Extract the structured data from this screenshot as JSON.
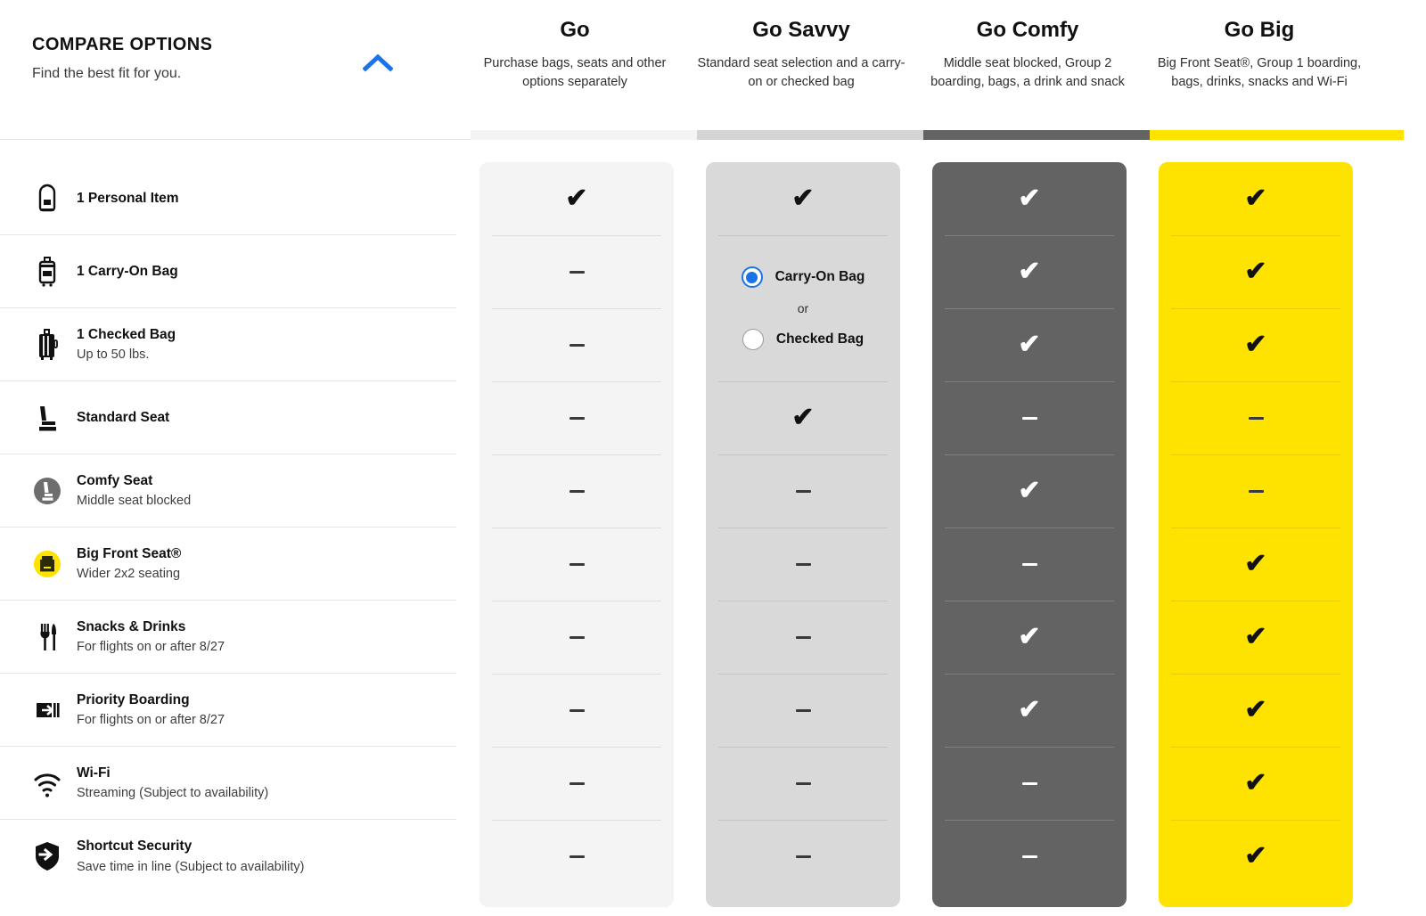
{
  "header": {
    "title": "COMPARE OPTIONS",
    "subtitle": "Find the best fit for you.",
    "collapse_icon": "chevron-up-icon",
    "accent_color": "#1a73e8"
  },
  "plans": [
    {
      "id": "go",
      "name": "Go",
      "description": "Purchase bags, seats and other options separately",
      "bar_color": "#f4f4f4",
      "card_color": "#f4f4f4",
      "theme": "light"
    },
    {
      "id": "go-savvy",
      "name": "Go Savvy",
      "description": "Standard seat selection and a carry-on or checked bag",
      "bar_color": "#d4d4d4",
      "card_color": "#d9d9d9",
      "theme": "light"
    },
    {
      "id": "go-comfy",
      "name": "Go Comfy",
      "description": "Middle seat blocked, Group 2 boarding, bags, a drink and snack",
      "bar_color": "#636363",
      "card_color": "#636363",
      "theme": "dark"
    },
    {
      "id": "go-big",
      "name": "Go Big",
      "description": "Big Front Seat®, Group 1 boarding, bags, drinks, snacks and Wi-Fi",
      "bar_color": "#ffe300",
      "card_color": "#ffe300",
      "theme": "light"
    }
  ],
  "features": [
    {
      "icon": "backpack-icon",
      "title": "1 Personal Item",
      "sub": ""
    },
    {
      "icon": "carry-on-bag-icon",
      "title": "1 Carry-On Bag",
      "sub": ""
    },
    {
      "icon": "checked-bag-icon",
      "title": "1 Checked Bag",
      "sub": "Up to 50 lbs."
    },
    {
      "icon": "standard-seat-icon",
      "title": "Standard Seat",
      "sub": ""
    },
    {
      "icon": "comfy-seat-icon",
      "title": "Comfy Seat",
      "sub": "Middle seat blocked"
    },
    {
      "icon": "big-front-seat-icon",
      "title": "Big Front Seat®",
      "sub": "Wider 2x2 seating"
    },
    {
      "icon": "snacks-drinks-icon",
      "title": "Snacks & Drinks",
      "sub": "For flights on or after 8/27"
    },
    {
      "icon": "priority-boarding-icon",
      "title": "Priority Boarding",
      "sub": "For flights on or after 8/27"
    },
    {
      "icon": "wifi-icon",
      "title": "Wi-Fi",
      "sub": "Streaming (Subject to availability)"
    },
    {
      "icon": "shortcut-security-icon",
      "title": "Shortcut Security",
      "sub": "Save time in line (Subject to availability)"
    }
  ],
  "matrix": {
    "go": [
      "check",
      "dash",
      "dash",
      "dash",
      "dash",
      "dash",
      "dash",
      "dash",
      "dash",
      "dash"
    ],
    "go-savvy": [
      "check",
      "radio",
      "radio",
      "check",
      "dash",
      "dash",
      "dash",
      "dash",
      "dash",
      "dash"
    ],
    "go-comfy": [
      "check",
      "check",
      "check",
      "dash",
      "check",
      "dash",
      "check",
      "check",
      "dash",
      "dash"
    ],
    "go-big": [
      "check",
      "check",
      "check",
      "dash",
      "dash",
      "check",
      "check",
      "check",
      "check",
      "check"
    ]
  },
  "savvy_bag_choice": {
    "options": [
      {
        "label": "Carry-On Bag",
        "selected": true
      },
      {
        "label": "Checked Bag",
        "selected": false
      }
    ],
    "divider_text": "or"
  },
  "glyphs": {
    "check": "✔"
  }
}
